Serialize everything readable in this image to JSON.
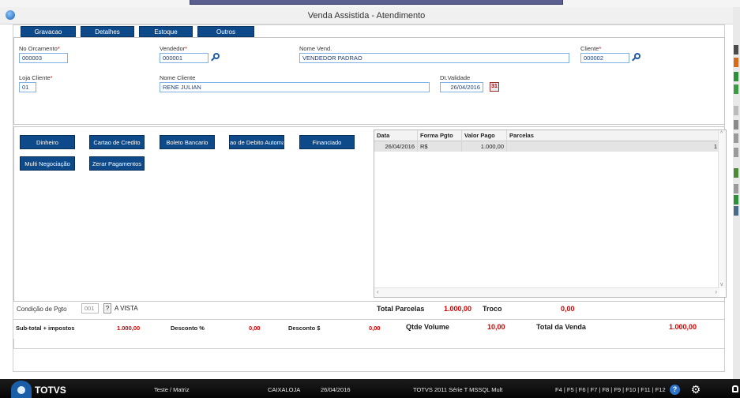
{
  "window": {
    "title": "Venda Assistida - Atendimento"
  },
  "folder_tabs": [
    "Gravacao",
    "Detalhes",
    "Estoque",
    "Outros"
  ],
  "header": {
    "orcamento": {
      "label": "No Orcamento",
      "value": "000003"
    },
    "vendedor": {
      "label": "Vendedor",
      "value": "000001"
    },
    "nome_vend": {
      "label": "Nome Vend.",
      "value": "VENDEDOR PADRAO"
    },
    "cliente": {
      "label": "Cliente",
      "value": "000002"
    },
    "loja_cliente": {
      "label": "Loja Cliente",
      "value": "01"
    },
    "nome_cliente": {
      "label": "Nome Cliente",
      "value": "RENE JULIAN"
    },
    "dt_validade": {
      "label": "Dt.Validade",
      "value": "26/04/2016"
    }
  },
  "payment_buttons": {
    "dinheiro": "Dinheiro",
    "cartao_credito": "Cartao de Credito",
    "boleto": "Boleto Bancario",
    "debito_auto": "ao de Debito Automa",
    "financiado": "Financiado",
    "multi_negociacao": "Multi Negociação",
    "zerar_pagamentos": "Zerar Pagamentos"
  },
  "payments_grid": {
    "columns": [
      "Data",
      "Forma Pgto",
      "Valor Pago",
      "Parcelas"
    ],
    "rows": [
      {
        "data": "26/04/2016",
        "forma": "R$",
        "valor": "1.000,00",
        "parcelas": "1"
      }
    ]
  },
  "condicao": {
    "label": "Condição de Pgto",
    "code": "001",
    "help": "?",
    "description": "A VISTA"
  },
  "totals": {
    "total_parcelas_label": "Total Parcelas",
    "total_parcelas_value": "1.000,00",
    "troco_label": "Troco",
    "troco_value": "0,00",
    "subtotal_label": "Sub-total + impostos",
    "subtotal_value": "1.000,00",
    "desconto_pct_label": "Desconto %",
    "desconto_pct_value": "0,00",
    "desconto_val_label": "Desconto $",
    "desconto_val_value": "0,00",
    "qtde_volume_label": "Qtde Volume",
    "qtde_volume_value": "10,00",
    "total_venda_label": "Total da Venda",
    "total_venda_value": "1.000,00"
  },
  "statusbar": {
    "brand": "TOTVS",
    "environment": "Teste / Matriz",
    "cashier": "CAIXALOJA",
    "date": "26/04/2016",
    "system": "TOTVS 2011 Série T  MSSQL Mult",
    "shortcuts": "F4 | F5 | F6 | F7 | F8 | F9 | F10 | F11 | F12"
  },
  "colors": {
    "button_blue": "#0e4a8a",
    "field_border": "#7fb0e6",
    "value_red": "#d40000"
  }
}
